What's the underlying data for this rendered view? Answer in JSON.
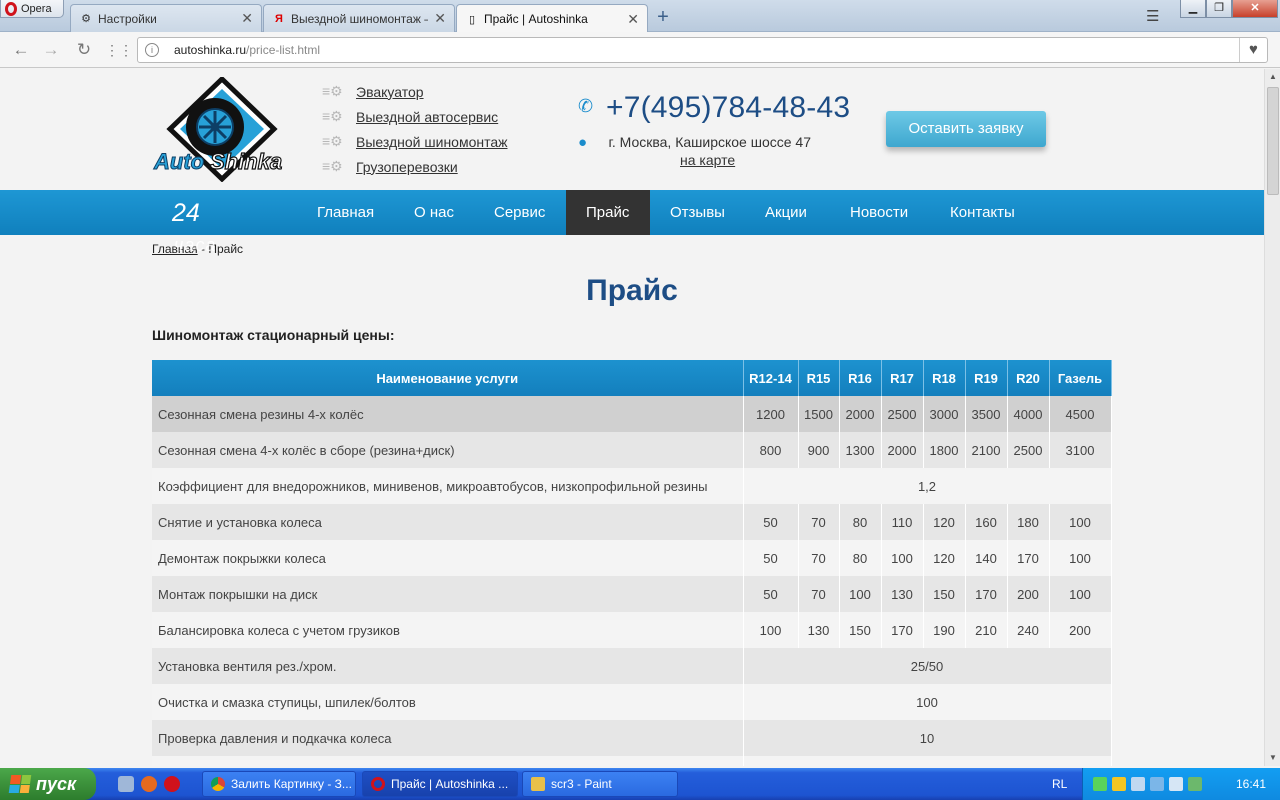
{
  "browser": {
    "menu_label": "Opera",
    "tabs": [
      {
        "title": "Настройки",
        "icon": "gear-icon"
      },
      {
        "title": "Выездной шиномонтаж — Я",
        "icon": "yandex-icon"
      },
      {
        "title": "Прайс | Autoshinka",
        "icon": "page-icon"
      }
    ],
    "url_domain": "autoshinka.ru",
    "url_path": "/price-list.html"
  },
  "header": {
    "logo_text_1": "Auto",
    "logo_text_2": "Shinka",
    "quick_links": [
      "Эвакуатор",
      "Выездной автосервис",
      "Выездной шиномонтаж",
      "Грузоперевозки"
    ],
    "phone": "+7(495)784-48-43",
    "address": "г. Москва, Каширское шоссе 47",
    "map_link": "на карте",
    "cta": "Оставить заявку"
  },
  "menu": {
    "badge": "24",
    "items": [
      "Главная",
      "О нас",
      "Сервис",
      "Прайс",
      "Отзывы",
      "Акции",
      "Новости",
      "Контакты"
    ],
    "active": "Прайс"
  },
  "breadcrumb": {
    "home": "Главная",
    "sep": " - ",
    "current": "Прайс",
    "overlay": "часа"
  },
  "page": {
    "title": "Прайс",
    "section_title": "Шиномонтаж стационарный цены:"
  },
  "table": {
    "headers": [
      "Наименование услуги",
      "R12-14",
      "R15",
      "R16",
      "R17",
      "R18",
      "R19",
      "R20",
      "Газель"
    ],
    "rows": [
      {
        "name": "Сезонная смена резины 4-х колёс",
        "values": [
          "1200",
          "1500",
          "2000",
          "2500",
          "3000",
          "3500",
          "4000",
          "4500"
        ]
      },
      {
        "name": "Сезонная смена 4-х колёс в сборе (резина+диск)",
        "values": [
          "800",
          "900",
          "1300",
          "2000",
          "1800",
          "2100",
          "2500",
          "3100"
        ]
      },
      {
        "name": "Коэффициент для внедорожников, минивенов, микроавтобусов, низкопрофильной резины",
        "values": [
          "1,2"
        ]
      },
      {
        "name": "Снятие и установка колеса",
        "values": [
          "50",
          "70",
          "80",
          "110",
          "120",
          "160",
          "180",
          "100"
        ]
      },
      {
        "name": "Демонтаж покрыжки колеса",
        "values": [
          "50",
          "70",
          "80",
          "100",
          "120",
          "140",
          "170",
          "100"
        ]
      },
      {
        "name": "Монтаж покрышки на диск",
        "values": [
          "50",
          "70",
          "100",
          "130",
          "150",
          "170",
          "200",
          "100"
        ]
      },
      {
        "name": "Балансировка колеса с учетом грузиков",
        "values": [
          "100",
          "130",
          "150",
          "170",
          "190",
          "210",
          "240",
          "200"
        ]
      },
      {
        "name": "Установка вентиля рез./хром.",
        "values": [
          "25/50"
        ]
      },
      {
        "name": "Очистка и смазка ступицы, шпилек/болтов",
        "values": [
          "100"
        ]
      },
      {
        "name": "Проверка давления и подкачка колеса",
        "values": [
          "10"
        ]
      },
      {
        "name": "",
        "values": [
          ""
        ]
      }
    ]
  },
  "taskbar": {
    "start": "пуск",
    "tasks": [
      "Залить Картинку - З...",
      "Прайс | Autoshinka ...",
      "scr3 - Paint"
    ],
    "lang": "RL",
    "clock": "16:41"
  }
}
